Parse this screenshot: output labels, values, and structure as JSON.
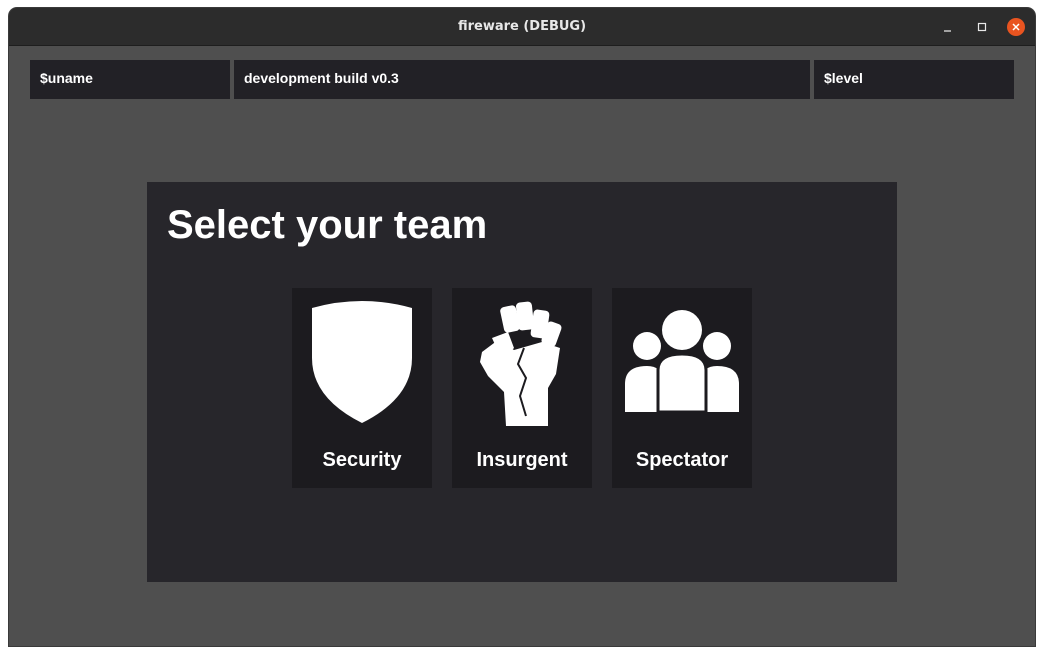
{
  "window": {
    "title": "fireware (DEBUG)"
  },
  "topbar": {
    "username": "$uname",
    "build": "development build v0.3",
    "level": "$level"
  },
  "team_select": {
    "heading": "Select your team",
    "teams": [
      {
        "label": "Security",
        "icon": "shield-icon"
      },
      {
        "label": "Insurgent",
        "icon": "raised-fist-icon"
      },
      {
        "label": "Spectator",
        "icon": "group-icon"
      }
    ]
  },
  "colors": {
    "window_bg": "#4f4f4f",
    "titlebar_bg": "#2c2c2c",
    "bar_bg": "#222126",
    "panel_bg": "#27262b",
    "card_bg": "#1c1b1f",
    "close_button": "#e95420",
    "text": "#ffffff"
  }
}
